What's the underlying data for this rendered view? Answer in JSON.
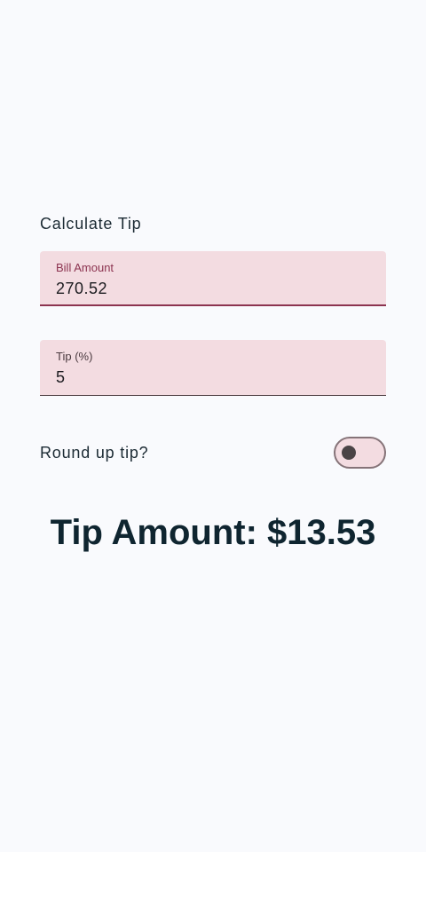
{
  "calculator": {
    "heading": "Calculate Tip",
    "bill_field": {
      "label": "Bill Amount",
      "value": "270.52"
    },
    "tip_field": {
      "label": "Tip (%)",
      "value": "5"
    },
    "round_up": {
      "label": "Round up tip?",
      "checked": false
    },
    "result": "Tip Amount: $13.53"
  },
  "colors": {
    "background": "#f9fafd",
    "field_fill": "#f3dce1",
    "accent": "#8c3350",
    "text": "#0f2530"
  }
}
